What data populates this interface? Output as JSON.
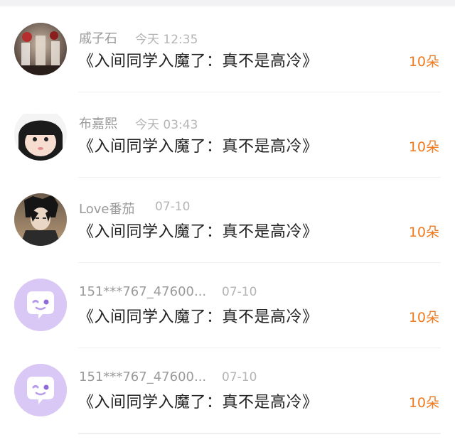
{
  "gifts": [
    {
      "name": "戚子石",
      "time": "今天 12:35",
      "title": "《入间同学入魔了：真不是高冷》",
      "count": "10朵",
      "avatar": "photo-lab-icon"
    },
    {
      "name": "布嘉熙",
      "time": "今天 03:43",
      "title": "《入间同学入魔了：真不是高冷》",
      "count": "10朵",
      "avatar": "child-photo-icon"
    },
    {
      "name": "Love番茄",
      "time": "07-10",
      "title": "《入间同学入魔了：真不是高冷》",
      "count": "10朵",
      "avatar": "anime-character-icon"
    },
    {
      "name": "151***767_47600...",
      "time": "07-10",
      "title": "《入间同学入魔了：真不是高冷》",
      "count": "10朵",
      "avatar": "chat-bubble-face-icon"
    },
    {
      "name": "151***767_47600...",
      "time": "07-10",
      "title": "《入间同学入魔了：真不是高冷》",
      "count": "10朵",
      "avatar": "chat-bubble-face-icon"
    }
  ],
  "colors": {
    "count": "#f07a1f",
    "default_avatar_bg": "#d9c7f5"
  }
}
